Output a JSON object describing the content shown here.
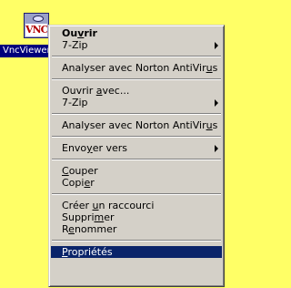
{
  "desktop_icon": {
    "logo_text": "VNC",
    "label": "VncViewer"
  },
  "menu": {
    "ouvrir_pre": "Ou",
    "ouvrir_ul": "v",
    "ouvrir_post": "rir",
    "zip1": "7-Zip",
    "norton1_pre": "Analyser avec Norton AntiVir",
    "norton1_ul": "u",
    "norton1_post": "s",
    "ouvrir_avec_pre": "Ouvrir ",
    "ouvrir_avec_ul": "a",
    "ouvrir_avec_post": "vec...",
    "zip2": "7-Zip",
    "norton2_pre": "Analyser avec Norton AntiVir",
    "norton2_ul": "u",
    "norton2_post": "s",
    "envoyer_pre": "Envo",
    "envoyer_ul": "y",
    "envoyer_post": "er vers",
    "couper_ul": "C",
    "couper_post": "ouper",
    "copier_pre": "Copi",
    "copier_ul": "e",
    "copier_post": "r",
    "raccourci_pre": "Créer ",
    "raccourci_ul": "u",
    "raccourci_post": "n raccourci",
    "supprimer_pre": "Suppri",
    "supprimer_ul": "m",
    "supprimer_post": "er",
    "renommer_pre": "R",
    "renommer_ul": "e",
    "renommer_post": "nommer",
    "proprietes_ul": "P",
    "proprietes_post": "ropriétés"
  },
  "colors": {
    "desktop": "#ffff66",
    "menu_bg": "#d4d0c8",
    "selection": "#0a246a"
  }
}
